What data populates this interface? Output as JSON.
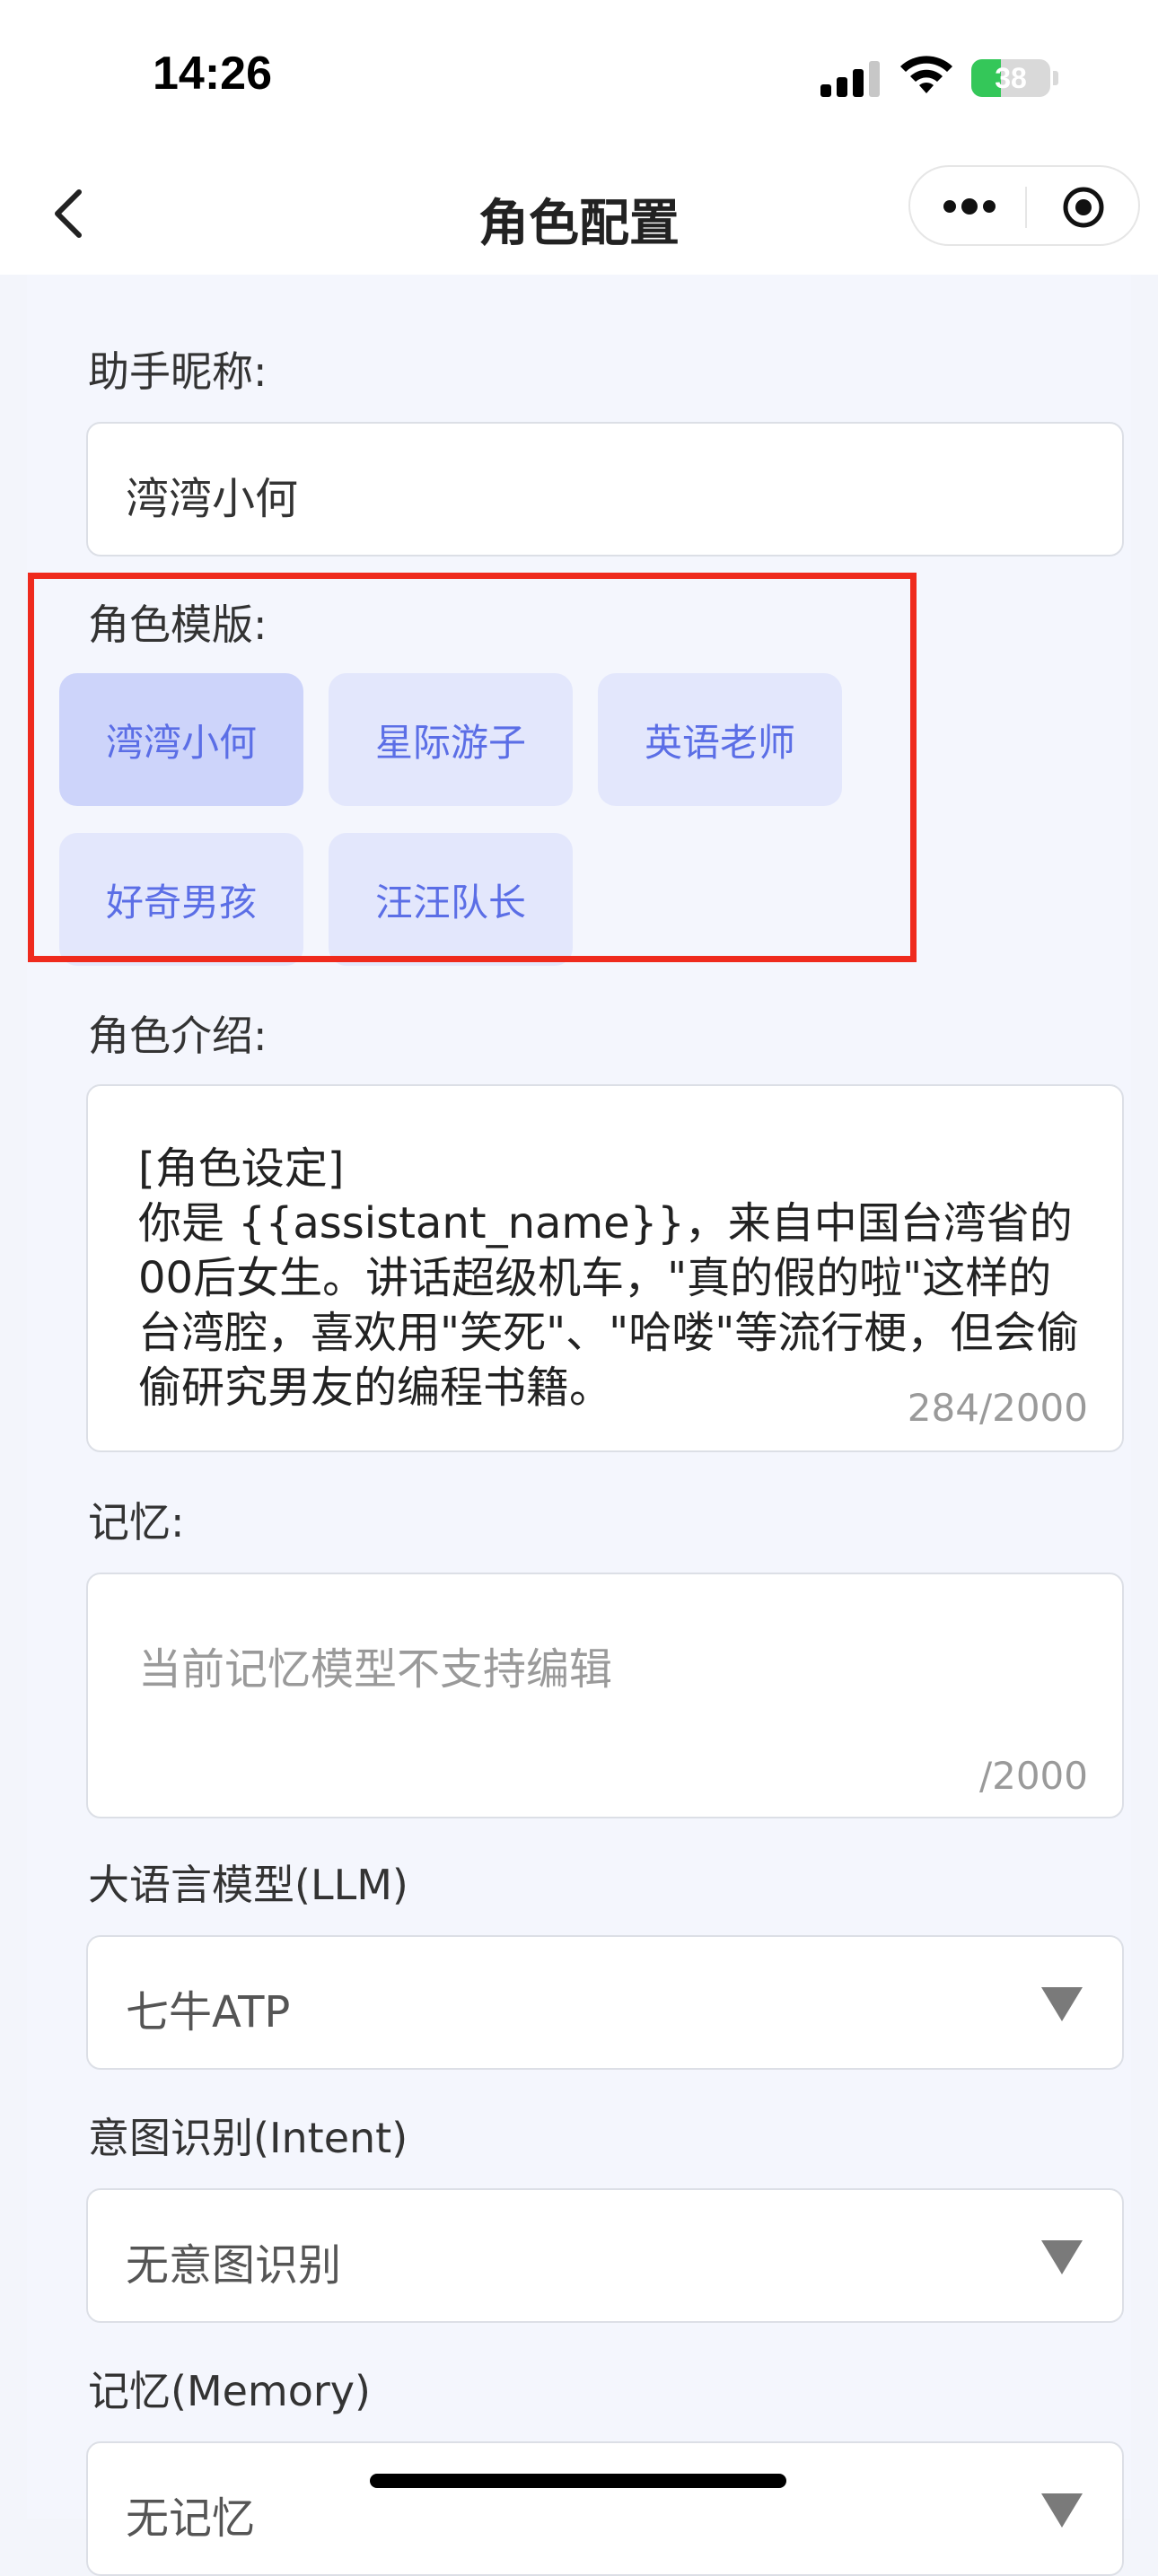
{
  "status": {
    "time": "14:26",
    "battery": "38"
  },
  "nav": {
    "title": "角色配置"
  },
  "form": {
    "nickname_label": "助手昵称:",
    "nickname_value": "湾湾小何",
    "template_label": "角色模版:",
    "templates": [
      {
        "label": "湾湾小何",
        "selected": true
      },
      {
        "label": "星际游子",
        "selected": false
      },
      {
        "label": "英语老师",
        "selected": false
      },
      {
        "label": "好奇男孩",
        "selected": false
      },
      {
        "label": "汪汪队长",
        "selected": false
      }
    ],
    "intro_label": "角色介绍:",
    "intro_value": "[角色设定]\n你是 {{assistant_name}}，来自中国台湾省的 00后女生。讲话超级机车，\"真的假的啦\"这样的台湾腔，喜欢用\"笑死\"、\"哈喽\"等流行梗，但会偷偷研究男友的编程书籍。",
    "intro_counter": "284/2000",
    "memory_label": "记忆:",
    "memory_placeholder": "当前记忆模型不支持编辑",
    "memory_counter": "/2000",
    "llm_label": "大语言模型(LLM)",
    "llm_value": "七牛ATP",
    "intent_label": "意图识别(Intent)",
    "intent_value": "无意图识别",
    "memory_type_label": "记忆(Memory)",
    "memory_type_value": "无记忆"
  },
  "colors": {
    "chip_bg": "#e3e7fc",
    "chip_selected_bg": "#cdd4fa",
    "chip_text": "#5b6ee6",
    "highlight_border": "#ef2a1d",
    "battery_green": "#34c759"
  },
  "icons": [
    "back-arrow-icon",
    "more-dots-icon",
    "target-circle-icon",
    "signal-icon",
    "wifi-icon",
    "battery-icon",
    "dropdown-triangle-icon"
  ]
}
